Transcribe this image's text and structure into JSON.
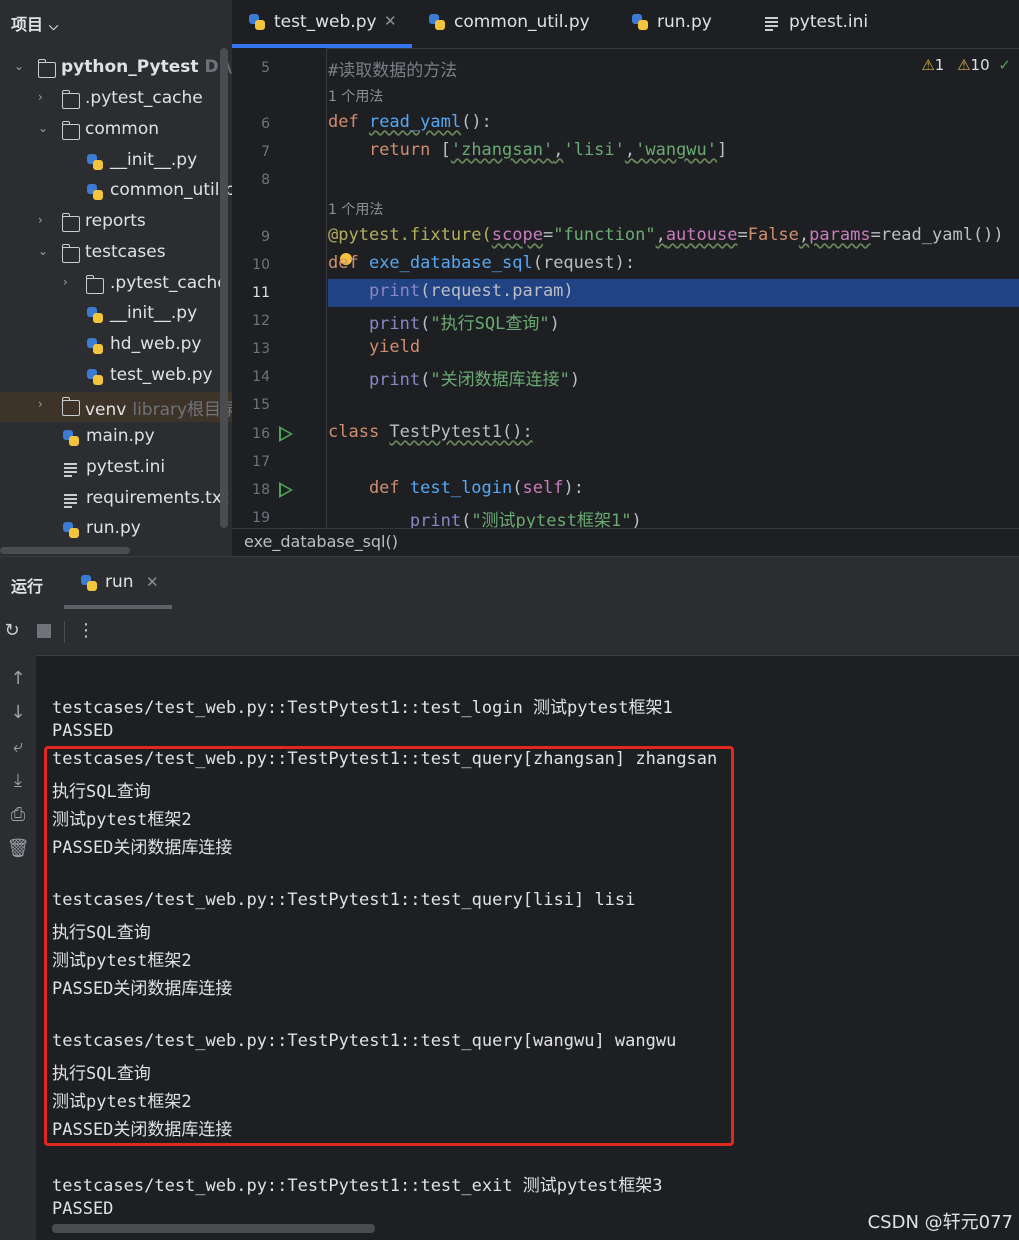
{
  "project": {
    "title": "项目",
    "items": [
      {
        "name": "python_Pytest",
        "hint": "D:\\So",
        "expanded": true,
        "kind": "folder"
      },
      {
        "name": ".pytest_cache",
        "kind": "folder"
      },
      {
        "name": "common",
        "expanded": true,
        "kind": "folder"
      },
      {
        "name": "__init__.py",
        "kind": "py"
      },
      {
        "name": "common_util.py",
        "kind": "py"
      },
      {
        "name": "reports",
        "kind": "folder"
      },
      {
        "name": "testcases",
        "expanded": true,
        "kind": "folder"
      },
      {
        "name": ".pytest_cache",
        "kind": "folder"
      },
      {
        "name": "__init__.py",
        "kind": "py"
      },
      {
        "name": "hd_web.py",
        "kind": "py"
      },
      {
        "name": "test_web.py",
        "kind": "py"
      },
      {
        "name": "venv",
        "hint": "library根目录",
        "kind": "folder"
      },
      {
        "name": "main.py",
        "kind": "py"
      },
      {
        "name": "pytest.ini",
        "kind": "file"
      },
      {
        "name": "requirements.txt",
        "kind": "file"
      },
      {
        "name": "run.py",
        "kind": "py"
      }
    ]
  },
  "editor": {
    "tabs": [
      {
        "label": "test_web.py",
        "active": true
      },
      {
        "label": "common_util.py"
      },
      {
        "label": "run.py"
      },
      {
        "label": "pytest.ini"
      }
    ],
    "inspection": {
      "warn1": "1",
      "warn2": "10"
    },
    "line_numbers": [
      "5",
      "6",
      "7",
      "8",
      "9",
      "10",
      "11",
      "12",
      "13",
      "14",
      "15",
      "16",
      "17",
      "18",
      "19"
    ],
    "current_line": "11",
    "hints": {
      "usage1": "1 个用法",
      "usage2": "1 个用法"
    },
    "code": {
      "l5": "#读取数据的方法",
      "l6_kw": "def ",
      "l6_fn": "read_yaml",
      "l6_rest": "():",
      "l7_kw": "    return ",
      "l7_b1": "[",
      "l7_s1": "'zhangsan'",
      "l7_c1": ",",
      "l7_s2": "'lisi'",
      "l7_c2": ",",
      "l7_s3": "'wangwu'",
      "l7_b2": "]",
      "l9_dec": "@pytest.fixture(",
      "l9_p1": "scope",
      "l9_eq1": "=",
      "l9_s1": "\"function\"",
      "l9_c1": ",",
      "l9_p2": "autouse",
      "l9_eq2": "=",
      "l9_v2": "False",
      "l9_c2": ",",
      "l9_p3": "params",
      "l9_eq3": "=",
      "l9_v3": "read_yaml())",
      "l10_kw": "def ",
      "l10_fn": "exe_database_sql",
      "l10_rest": "(request):",
      "l11_bi": "    print",
      "l11_rest": "(request.param)",
      "l12_bi": "    print",
      "l12_p": "(",
      "l12_s": "\"执行SQL查询\"",
      "l12_e": ")",
      "l13_kw": "    yield",
      "l14_bi": "    print",
      "l14_p": "(",
      "l14_s": "\"关闭数据库连接\"",
      "l14_e": ")",
      "l16_kw": "class ",
      "l16_rest": "TestPytest1():",
      "l18_kw": "    def ",
      "l18_fn": "test_login",
      "l18_p": "(",
      "l18_self": "self",
      "l18_e": "):",
      "l19_bi": "        print",
      "l19_p": "(",
      "l19_s": "\"测试pytest框架1\"",
      "l19_e": ")"
    },
    "breadcrumb": "exe_database_sql()"
  },
  "run": {
    "title": "运行",
    "tab_label": "run",
    "output": [
      "testcases/test_web.py::TestPytest1::test_login 测试pytest框架1",
      "PASSED",
      "testcases/test_web.py::TestPytest1::test_query[zhangsan] zhangsan",
      "执行SQL查询",
      "测试pytest框架2",
      "PASSED关闭数据库连接",
      "",
      "testcases/test_web.py::TestPytest1::test_query[lisi] lisi",
      "执行SQL查询",
      "测试pytest框架2",
      "PASSED关闭数据库连接",
      "",
      "testcases/test_web.py::TestPytest1::test_query[wangwu] wangwu",
      "执行SQL查询",
      "测试pytest框架2",
      "PASSED关闭数据库连接",
      "",
      "testcases/test_web.py::TestPytest1::test_exit 测试pytest框架3",
      "PASSED"
    ]
  },
  "watermark": "CSDN @轩元077",
  "colors": {
    "accent": "#3574f0",
    "highlight_box": "#e0281f",
    "selection": "#214283"
  }
}
